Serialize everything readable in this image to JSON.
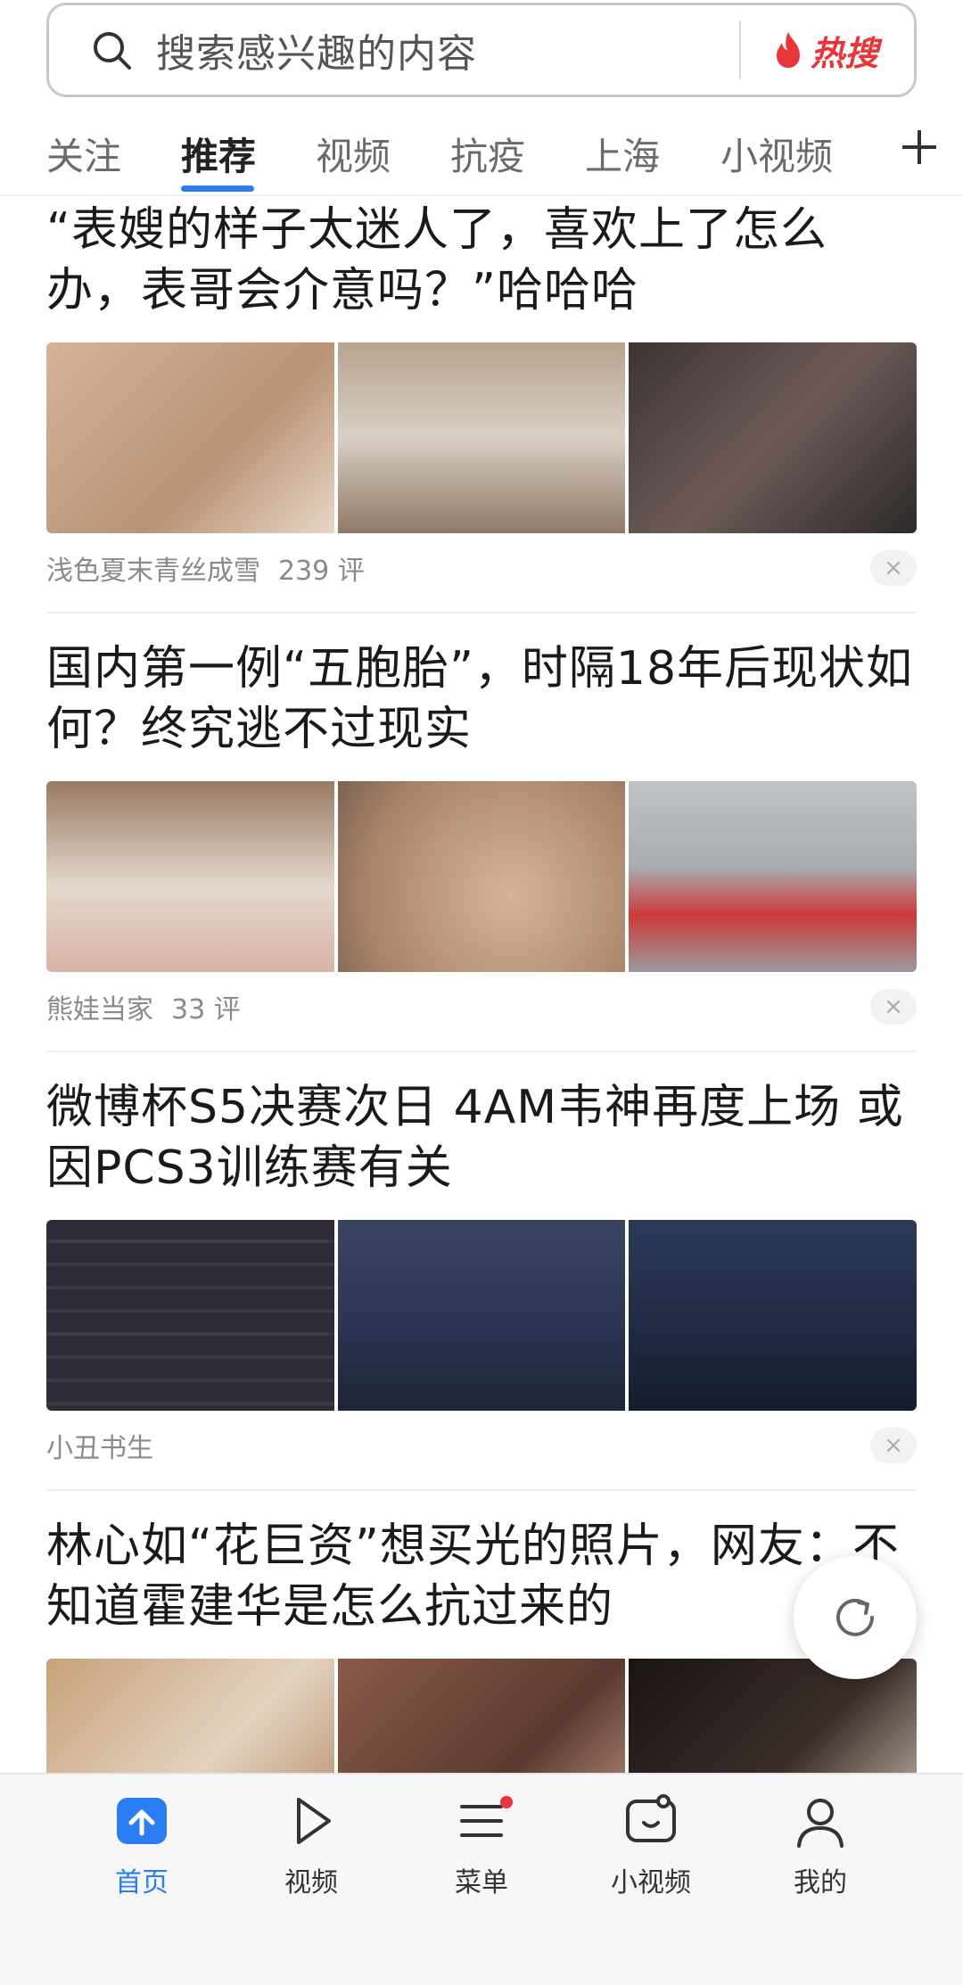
{
  "search": {
    "placeholder": "搜索感兴趣的内容",
    "hot_label": "热搜"
  },
  "tabs": [
    {
      "label": "关注",
      "active": false
    },
    {
      "label": "推荐",
      "active": true
    },
    {
      "label": "视频",
      "active": false
    },
    {
      "label": "抗疫",
      "active": false
    },
    {
      "label": "上海",
      "active": false
    },
    {
      "label": "小视频",
      "active": false
    }
  ],
  "articles": [
    {
      "title": "“表嫂的样子太迷人了，喜欢上了怎么办，表哥会介意吗？”哈哈哈",
      "source": "浅色夏末青丝成雪",
      "comments": "239 评",
      "image_colors": [
        "#c9a78c",
        "#b8a48f",
        "#5a4a48"
      ]
    },
    {
      "title": "国内第一例“五胞胎”，时隔18年后现状如何？终究逃不过现实",
      "source": "熊娃当家",
      "comments": "33 评",
      "image_colors": [
        "#a98b78",
        "#c6a58a",
        "#9a9a9c"
      ]
    },
    {
      "title": "微博杯S5决赛次日 4AM韦神再度上场 或因PCS3训练赛有关",
      "source": "小丑书生",
      "comments": "",
      "image_colors": [
        "#2e2a36",
        "#2c3550",
        "#1f2942"
      ]
    },
    {
      "title": "林心如“花巨资”想买光的照片，网友：不知道霍建华是怎么抗过来的",
      "source": "",
      "comments": "",
      "image_colors": [
        "#c7a27a",
        "#6a4a3c",
        "#2a2220"
      ]
    }
  ],
  "close_symbol": "×",
  "bottom_nav": [
    {
      "label": "首页",
      "icon": "home-icon",
      "active": true
    },
    {
      "label": "视频",
      "icon": "play-icon",
      "active": false
    },
    {
      "label": "菜单",
      "icon": "menu-icon",
      "active": false,
      "badge": true
    },
    {
      "label": "小视频",
      "icon": "short-video-icon",
      "active": false
    },
    {
      "label": "我的",
      "icon": "profile-icon",
      "active": false
    }
  ],
  "colors": {
    "accent": "#2a7df3",
    "hot": "#e8353a"
  }
}
